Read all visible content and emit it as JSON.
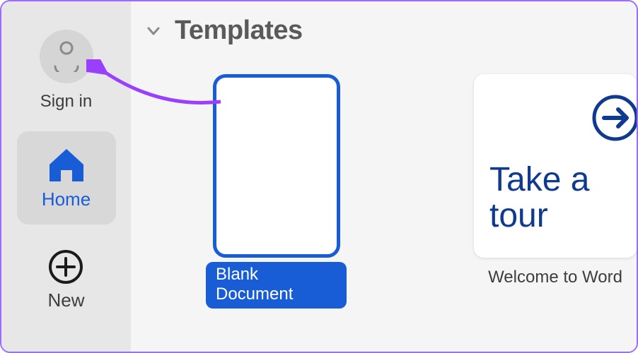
{
  "sidebar": {
    "signin_label": "Sign in",
    "home_label": "Home",
    "new_label": "New"
  },
  "section": {
    "title": "Templates"
  },
  "templates": [
    {
      "caption": "Blank Document",
      "selected": true
    },
    {
      "caption": "Welcome to Word",
      "tour_text": "Take a tour"
    }
  ],
  "colors": {
    "accent": "#185dd6",
    "sidebar_bg": "#e7e7e8",
    "main_bg": "#f5f5f6",
    "annotation": "#9b3fff",
    "tour_text": "#0f3a8f"
  }
}
